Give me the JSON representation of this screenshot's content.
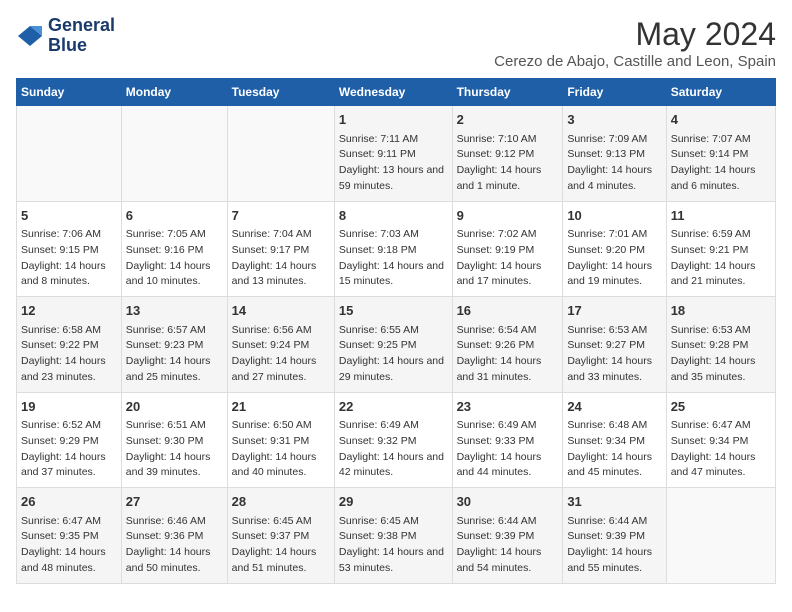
{
  "logo": {
    "line1": "General",
    "line2": "Blue"
  },
  "title": "May 2024",
  "subtitle": "Cerezo de Abajo, Castille and Leon, Spain",
  "days_header": [
    "Sunday",
    "Monday",
    "Tuesday",
    "Wednesday",
    "Thursday",
    "Friday",
    "Saturday"
  ],
  "weeks": [
    [
      {
        "day": "",
        "info": ""
      },
      {
        "day": "",
        "info": ""
      },
      {
        "day": "",
        "info": ""
      },
      {
        "day": "1",
        "info": "Sunrise: 7:11 AM\nSunset: 9:11 PM\nDaylight: 13 hours and 59 minutes."
      },
      {
        "day": "2",
        "info": "Sunrise: 7:10 AM\nSunset: 9:12 PM\nDaylight: 14 hours and 1 minute."
      },
      {
        "day": "3",
        "info": "Sunrise: 7:09 AM\nSunset: 9:13 PM\nDaylight: 14 hours and 4 minutes."
      },
      {
        "day": "4",
        "info": "Sunrise: 7:07 AM\nSunset: 9:14 PM\nDaylight: 14 hours and 6 minutes."
      }
    ],
    [
      {
        "day": "5",
        "info": "Sunrise: 7:06 AM\nSunset: 9:15 PM\nDaylight: 14 hours and 8 minutes."
      },
      {
        "day": "6",
        "info": "Sunrise: 7:05 AM\nSunset: 9:16 PM\nDaylight: 14 hours and 10 minutes."
      },
      {
        "day": "7",
        "info": "Sunrise: 7:04 AM\nSunset: 9:17 PM\nDaylight: 14 hours and 13 minutes."
      },
      {
        "day": "8",
        "info": "Sunrise: 7:03 AM\nSunset: 9:18 PM\nDaylight: 14 hours and 15 minutes."
      },
      {
        "day": "9",
        "info": "Sunrise: 7:02 AM\nSunset: 9:19 PM\nDaylight: 14 hours and 17 minutes."
      },
      {
        "day": "10",
        "info": "Sunrise: 7:01 AM\nSunset: 9:20 PM\nDaylight: 14 hours and 19 minutes."
      },
      {
        "day": "11",
        "info": "Sunrise: 6:59 AM\nSunset: 9:21 PM\nDaylight: 14 hours and 21 minutes."
      }
    ],
    [
      {
        "day": "12",
        "info": "Sunrise: 6:58 AM\nSunset: 9:22 PM\nDaylight: 14 hours and 23 minutes."
      },
      {
        "day": "13",
        "info": "Sunrise: 6:57 AM\nSunset: 9:23 PM\nDaylight: 14 hours and 25 minutes."
      },
      {
        "day": "14",
        "info": "Sunrise: 6:56 AM\nSunset: 9:24 PM\nDaylight: 14 hours and 27 minutes."
      },
      {
        "day": "15",
        "info": "Sunrise: 6:55 AM\nSunset: 9:25 PM\nDaylight: 14 hours and 29 minutes."
      },
      {
        "day": "16",
        "info": "Sunrise: 6:54 AM\nSunset: 9:26 PM\nDaylight: 14 hours and 31 minutes."
      },
      {
        "day": "17",
        "info": "Sunrise: 6:53 AM\nSunset: 9:27 PM\nDaylight: 14 hours and 33 minutes."
      },
      {
        "day": "18",
        "info": "Sunrise: 6:53 AM\nSunset: 9:28 PM\nDaylight: 14 hours and 35 minutes."
      }
    ],
    [
      {
        "day": "19",
        "info": "Sunrise: 6:52 AM\nSunset: 9:29 PM\nDaylight: 14 hours and 37 minutes."
      },
      {
        "day": "20",
        "info": "Sunrise: 6:51 AM\nSunset: 9:30 PM\nDaylight: 14 hours and 39 minutes."
      },
      {
        "day": "21",
        "info": "Sunrise: 6:50 AM\nSunset: 9:31 PM\nDaylight: 14 hours and 40 minutes."
      },
      {
        "day": "22",
        "info": "Sunrise: 6:49 AM\nSunset: 9:32 PM\nDaylight: 14 hours and 42 minutes."
      },
      {
        "day": "23",
        "info": "Sunrise: 6:49 AM\nSunset: 9:33 PM\nDaylight: 14 hours and 44 minutes."
      },
      {
        "day": "24",
        "info": "Sunrise: 6:48 AM\nSunset: 9:34 PM\nDaylight: 14 hours and 45 minutes."
      },
      {
        "day": "25",
        "info": "Sunrise: 6:47 AM\nSunset: 9:34 PM\nDaylight: 14 hours and 47 minutes."
      }
    ],
    [
      {
        "day": "26",
        "info": "Sunrise: 6:47 AM\nSunset: 9:35 PM\nDaylight: 14 hours and 48 minutes."
      },
      {
        "day": "27",
        "info": "Sunrise: 6:46 AM\nSunset: 9:36 PM\nDaylight: 14 hours and 50 minutes."
      },
      {
        "day": "28",
        "info": "Sunrise: 6:45 AM\nSunset: 9:37 PM\nDaylight: 14 hours and 51 minutes."
      },
      {
        "day": "29",
        "info": "Sunrise: 6:45 AM\nSunset: 9:38 PM\nDaylight: 14 hours and 53 minutes."
      },
      {
        "day": "30",
        "info": "Sunrise: 6:44 AM\nSunset: 9:39 PM\nDaylight: 14 hours and 54 minutes."
      },
      {
        "day": "31",
        "info": "Sunrise: 6:44 AM\nSunset: 9:39 PM\nDaylight: 14 hours and 55 minutes."
      },
      {
        "day": "",
        "info": ""
      }
    ]
  ]
}
